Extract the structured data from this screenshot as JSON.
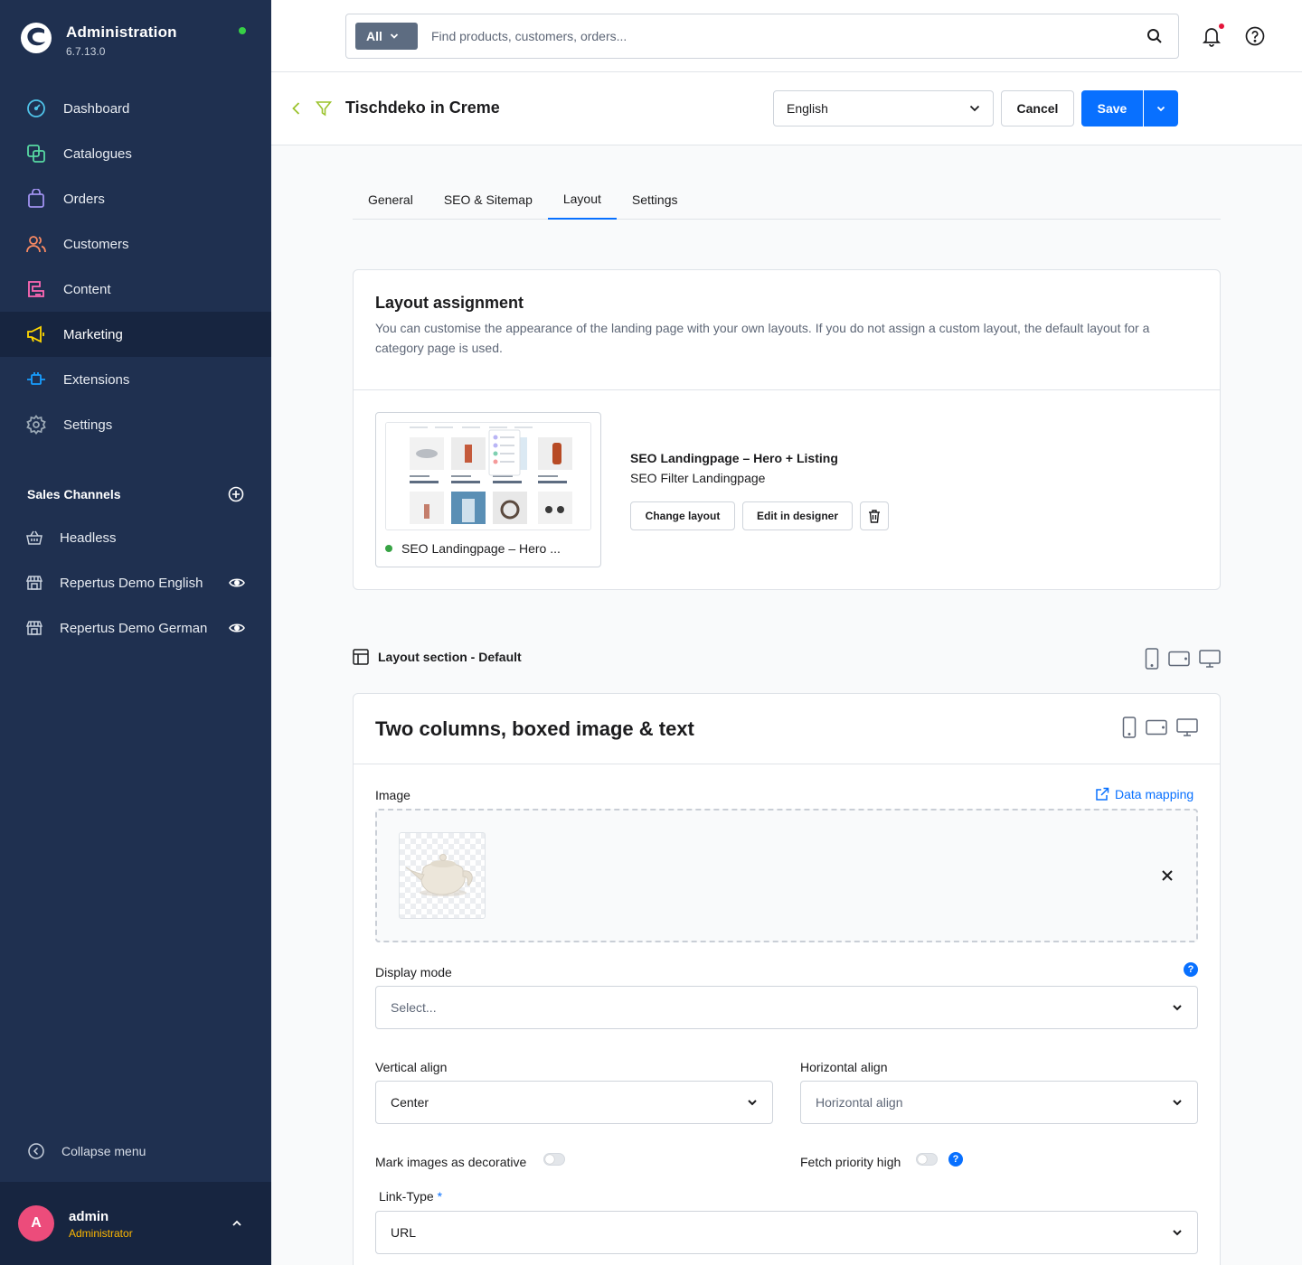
{
  "app": {
    "title": "Administration",
    "version": "6.7.13.0"
  },
  "sidebar": {
    "items": [
      {
        "label": "Dashboard",
        "icon": "gauge-icon",
        "color": "#4fc2e8"
      },
      {
        "label": "Catalogues",
        "icon": "catalogue-icon",
        "color": "#57d9a3"
      },
      {
        "label": "Orders",
        "icon": "shopping-bag-icon",
        "color": "#a092f0"
      },
      {
        "label": "Customers",
        "icon": "users-icon",
        "color": "#f88962"
      },
      {
        "label": "Content",
        "icon": "content-icon",
        "color": "#ff68b4"
      },
      {
        "label": "Marketing",
        "icon": "megaphone-icon",
        "color": "#ffd700"
      },
      {
        "label": "Extensions",
        "icon": "plug-icon",
        "color": "#189eff"
      },
      {
        "label": "Settings",
        "icon": "gear-icon",
        "color": "#9aa8b5"
      }
    ],
    "active": "Marketing",
    "sales_channels_title": "Sales Channels",
    "sales_channels": [
      {
        "label": "Headless",
        "icon": "basket-icon",
        "visible_icon": false
      },
      {
        "label": "Repertus Demo English",
        "icon": "storefront-icon",
        "visible_icon": true
      },
      {
        "label": "Repertus Demo German",
        "icon": "storefront-icon",
        "visible_icon": true
      }
    ],
    "collapse_label": "Collapse menu",
    "user": {
      "initial": "A",
      "name": "admin",
      "role": "Administrator"
    }
  },
  "topbar": {
    "search_type": "All",
    "search_placeholder": "Find products, customers, orders..."
  },
  "page": {
    "title": "Tischdeko in Creme",
    "language": "English",
    "cancel_label": "Cancel",
    "save_label": "Save"
  },
  "tabs": [
    {
      "label": "General",
      "active": false
    },
    {
      "label": "SEO & Sitemap",
      "active": false
    },
    {
      "label": "Layout",
      "active": true
    },
    {
      "label": "Settings",
      "active": false
    }
  ],
  "layout_assignment": {
    "title": "Layout assignment",
    "description": "You can customise the appearance of the landing page with your own layouts. If you do not assign a custom layout, the default layout for a category page is used.",
    "preview_caption": "SEO Landingpage – Hero ...",
    "layout_name": "SEO Landingpage – Hero + Listing",
    "layout_type": "SEO Filter Landingpage",
    "change_label": "Change layout",
    "edit_label": "Edit in designer"
  },
  "layout_section": {
    "label": "Layout section - Default"
  },
  "block": {
    "title": "Two columns, boxed image & text",
    "image_label": "Image",
    "data_mapping_label": "Data mapping",
    "display_mode_label": "Display mode",
    "display_mode_placeholder": "Select...",
    "vertical_align_label": "Vertical align",
    "vertical_align_value": "Center",
    "horizontal_align_label": "Horizontal align",
    "horizontal_align_placeholder": "Horizontal align",
    "decorative_label": "Mark images as decorative",
    "fetch_priority_label": "Fetch priority high",
    "link_type_label": "Link-Type",
    "link_type_required": "*",
    "link_type_value": "URL"
  },
  "colors": {
    "sidebar_bg": "#1f3050",
    "primary": "#0870ff",
    "status_online": "#37d046"
  }
}
